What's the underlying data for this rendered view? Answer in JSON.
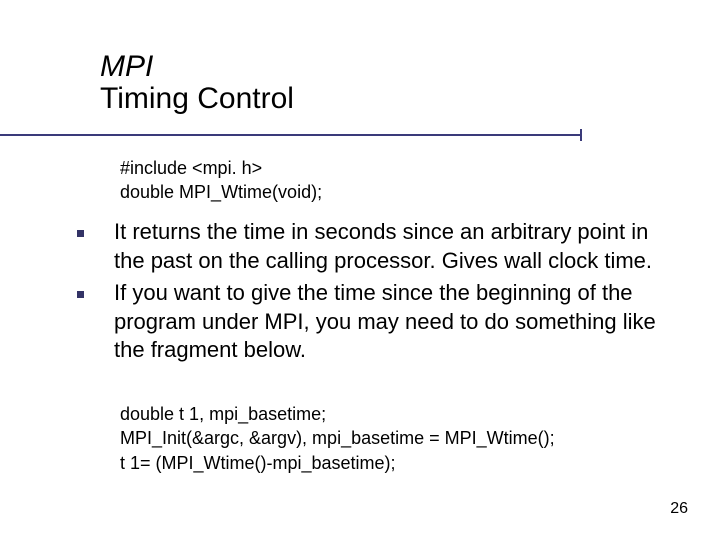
{
  "title": {
    "mpi": "MPI",
    "sub": "Timing Control"
  },
  "code_top": {
    "line1": "#include <mpi. h>",
    "line2": "double MPI_Wtime(void);"
  },
  "bullets": {
    "b1": "It returns the time in seconds since an arbitrary point in the past on the calling processor. Gives wall clock time.",
    "b2": "If you want to give the time since the beginning of the program under MPI, you may need to do something like the fragment below."
  },
  "code_bottom": {
    "line1": "double t 1, mpi_basetime;",
    "line2": "MPI_Init(&argc, &argv), mpi_basetime = MPI_Wtime();",
    "line3": "t 1= (MPI_Wtime()-mpi_basetime);"
  },
  "page_number": "26"
}
